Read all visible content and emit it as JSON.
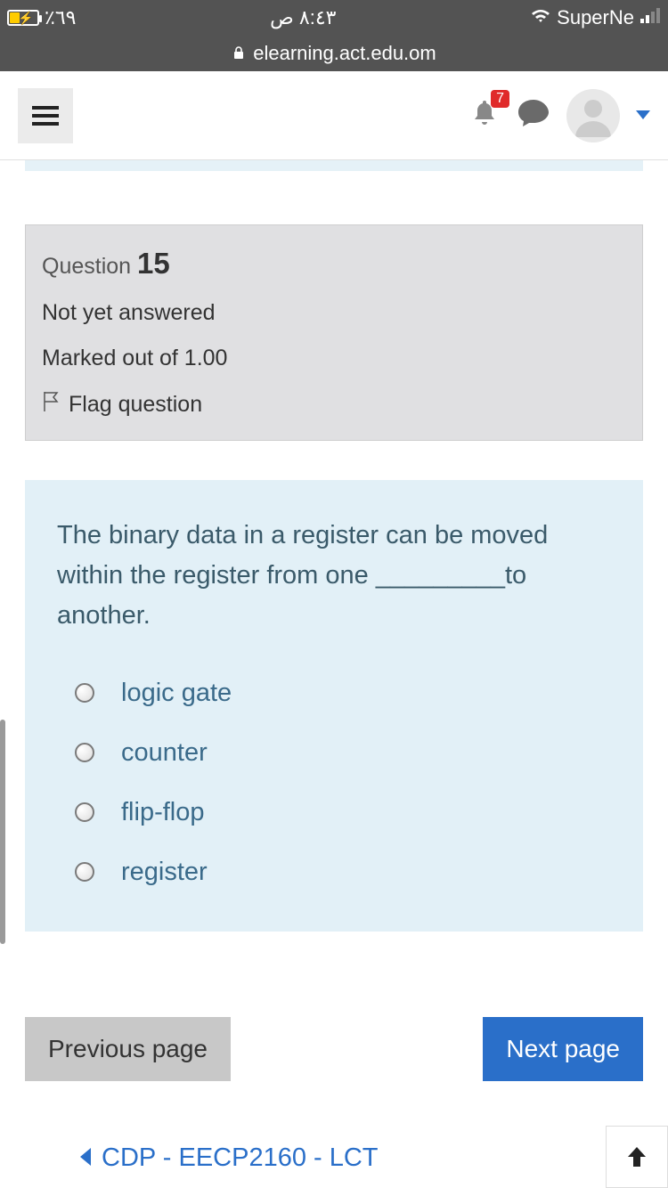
{
  "status": {
    "battery_text": "٪٦٩",
    "time": "٨:٤٣ ص",
    "carrier": "SuperNe"
  },
  "url": {
    "domain": "elearning.act.edu.om"
  },
  "nav": {
    "notification_count": "7"
  },
  "question": {
    "label": "Question",
    "number": "15",
    "status": "Not yet answered",
    "marks": "Marked out of 1.00",
    "flag": "Flag question",
    "text": "The binary data in a register can be moved within the register from one _________to another.",
    "options": [
      "logic gate",
      "counter",
      "flip-flop",
      "register"
    ]
  },
  "pager": {
    "prev": "Previous page",
    "next": "Next page"
  },
  "footer": {
    "course_link": "CDP - EECP2160 - LCT"
  }
}
